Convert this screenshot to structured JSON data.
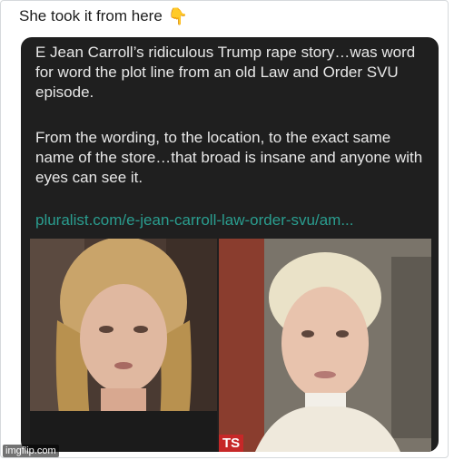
{
  "tweet": {
    "text": "She took it from here",
    "emoji_icon": "backhand-index-pointing-down-icon"
  },
  "card": {
    "paragraph1": "E Jean Carroll’s ridiculous Trump rape story…was word for word the plot line from an old Law and Order SVU episode.",
    "paragraph2": "From the wording, to the location, to the exact same name of the store…that broad is insane and anyone with eyes can see it.",
    "link": "pluralist.com/e-jean-carroll-law-order-svu/am..."
  },
  "photos": {
    "right_badge": "TS"
  },
  "watermark": "imgflip.com",
  "colors": {
    "card_bg": "#1f1f1f",
    "link": "#2a9d8f",
    "badge": "#c62828"
  }
}
